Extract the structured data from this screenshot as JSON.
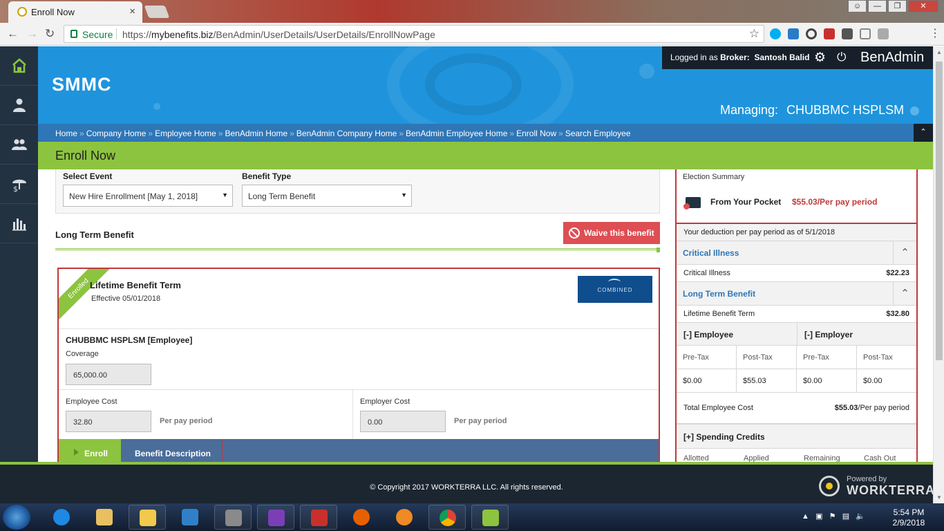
{
  "browser": {
    "tab_title": "Enroll Now",
    "tab_close": "×",
    "secure_label": "Secure",
    "url_scheme": "https://",
    "url_host": "mybenefits.biz",
    "url_path": "/BenAdmin/UserDetails/UserDetails/EnrollNowPage",
    "extension_icons": [
      "skype-icon",
      "saml-icon",
      "hub-icon",
      "pdf-icon",
      "notes-icon",
      "extension-icon",
      "grammarly-icon"
    ]
  },
  "header": {
    "brand": "SMMC",
    "logged_in_prefix": "Logged in as",
    "role": "Broker:",
    "user_name": "Santosh Balid",
    "app_name": "BenAdmin",
    "managing_label": "Managing:",
    "managing_value": "CHUBBMC HSPLSM"
  },
  "sidenav": {
    "items": [
      "home-icon",
      "employee-icon",
      "employees-icon",
      "benefits-icon",
      "reports-icon"
    ],
    "accent": "#8cc43f"
  },
  "breadcrumb": {
    "items": [
      "Home",
      "Company Home",
      "Employee Home",
      "BenAdmin Home",
      "BenAdmin Company Home",
      "BenAdmin Employee Home",
      "Enroll Now",
      "Search Employee"
    ],
    "separator": "»"
  },
  "page_title": "Enroll Now",
  "form": {
    "event_label": "Select Event",
    "event_value": "New Hire Enrollment [May 1, 2018]",
    "benefit_type_label": "Benefit Type",
    "benefit_type_value": "Long Term Benefit"
  },
  "section": {
    "title": "Long Term Benefit",
    "waive_button": "Waive this benefit"
  },
  "plan_card": {
    "ribbon": "Enrolled",
    "plan_name": "Lifetime Benefit Term",
    "effective": "Effective 05/01/2018",
    "carrier_logo_text": "COMBINED",
    "employee_line": "CHUBBMC HSPLSM [Employee]",
    "coverage_label": "Coverage",
    "coverage_value": "65,000.00",
    "employee_cost_label": "Employee Cost",
    "employee_cost_value": "32.80",
    "employer_cost_label": "Employer Cost",
    "employer_cost_value": "0.00",
    "per_pay_period": "Per pay period",
    "tab_enroll": "Enroll",
    "tab_description": "Benefit Description"
  },
  "summary": {
    "title": "Election Summary",
    "from_pocket_label": "From Your Pocket",
    "from_pocket_value": "$55.03/Per pay period",
    "deduction_note": "Your deduction per pay period as of 5/1/2018",
    "groups": [
      {
        "name": "Critical Illness",
        "line_label": "Critical Illness",
        "line_value": "$22.23"
      },
      {
        "name": "Long Term Benefit",
        "line_label": "Lifetime Benefit Term",
        "line_value": "$32.80"
      }
    ],
    "employee_header": "[-] Employee",
    "employer_header": "[-] Employer",
    "pre_tax": "Pre-Tax",
    "post_tax": "Post-Tax",
    "employee_pre": "$0.00",
    "employee_post": "$55.03",
    "employer_pre": "$0.00",
    "employer_post": "$0.00",
    "total_label": "Total Employee Cost",
    "total_value": "$55.03",
    "total_suffix": "/Per pay period",
    "spending_credits": "[+] Spending Credits",
    "credit_columns": [
      "Allotted",
      "Applied",
      "Remaining",
      "Cash Out"
    ]
  },
  "footer": {
    "copyright": "© Copyright 2017 WORKTERRA LLC. All rights reserved.",
    "powered_by": "Powered by",
    "powered_brand": "WORKTERRA"
  },
  "taskbar": {
    "time": "5:54 PM",
    "date": "2/9/2018",
    "apps": [
      "ie-icon",
      "explorer-icon",
      "outlook-icon",
      "media-icon",
      "tools-icon",
      "visualstudio-icon",
      "acrobat-icon",
      "firefox-icon",
      "app-icon",
      "chrome-icon",
      "notepad-icon"
    ]
  }
}
